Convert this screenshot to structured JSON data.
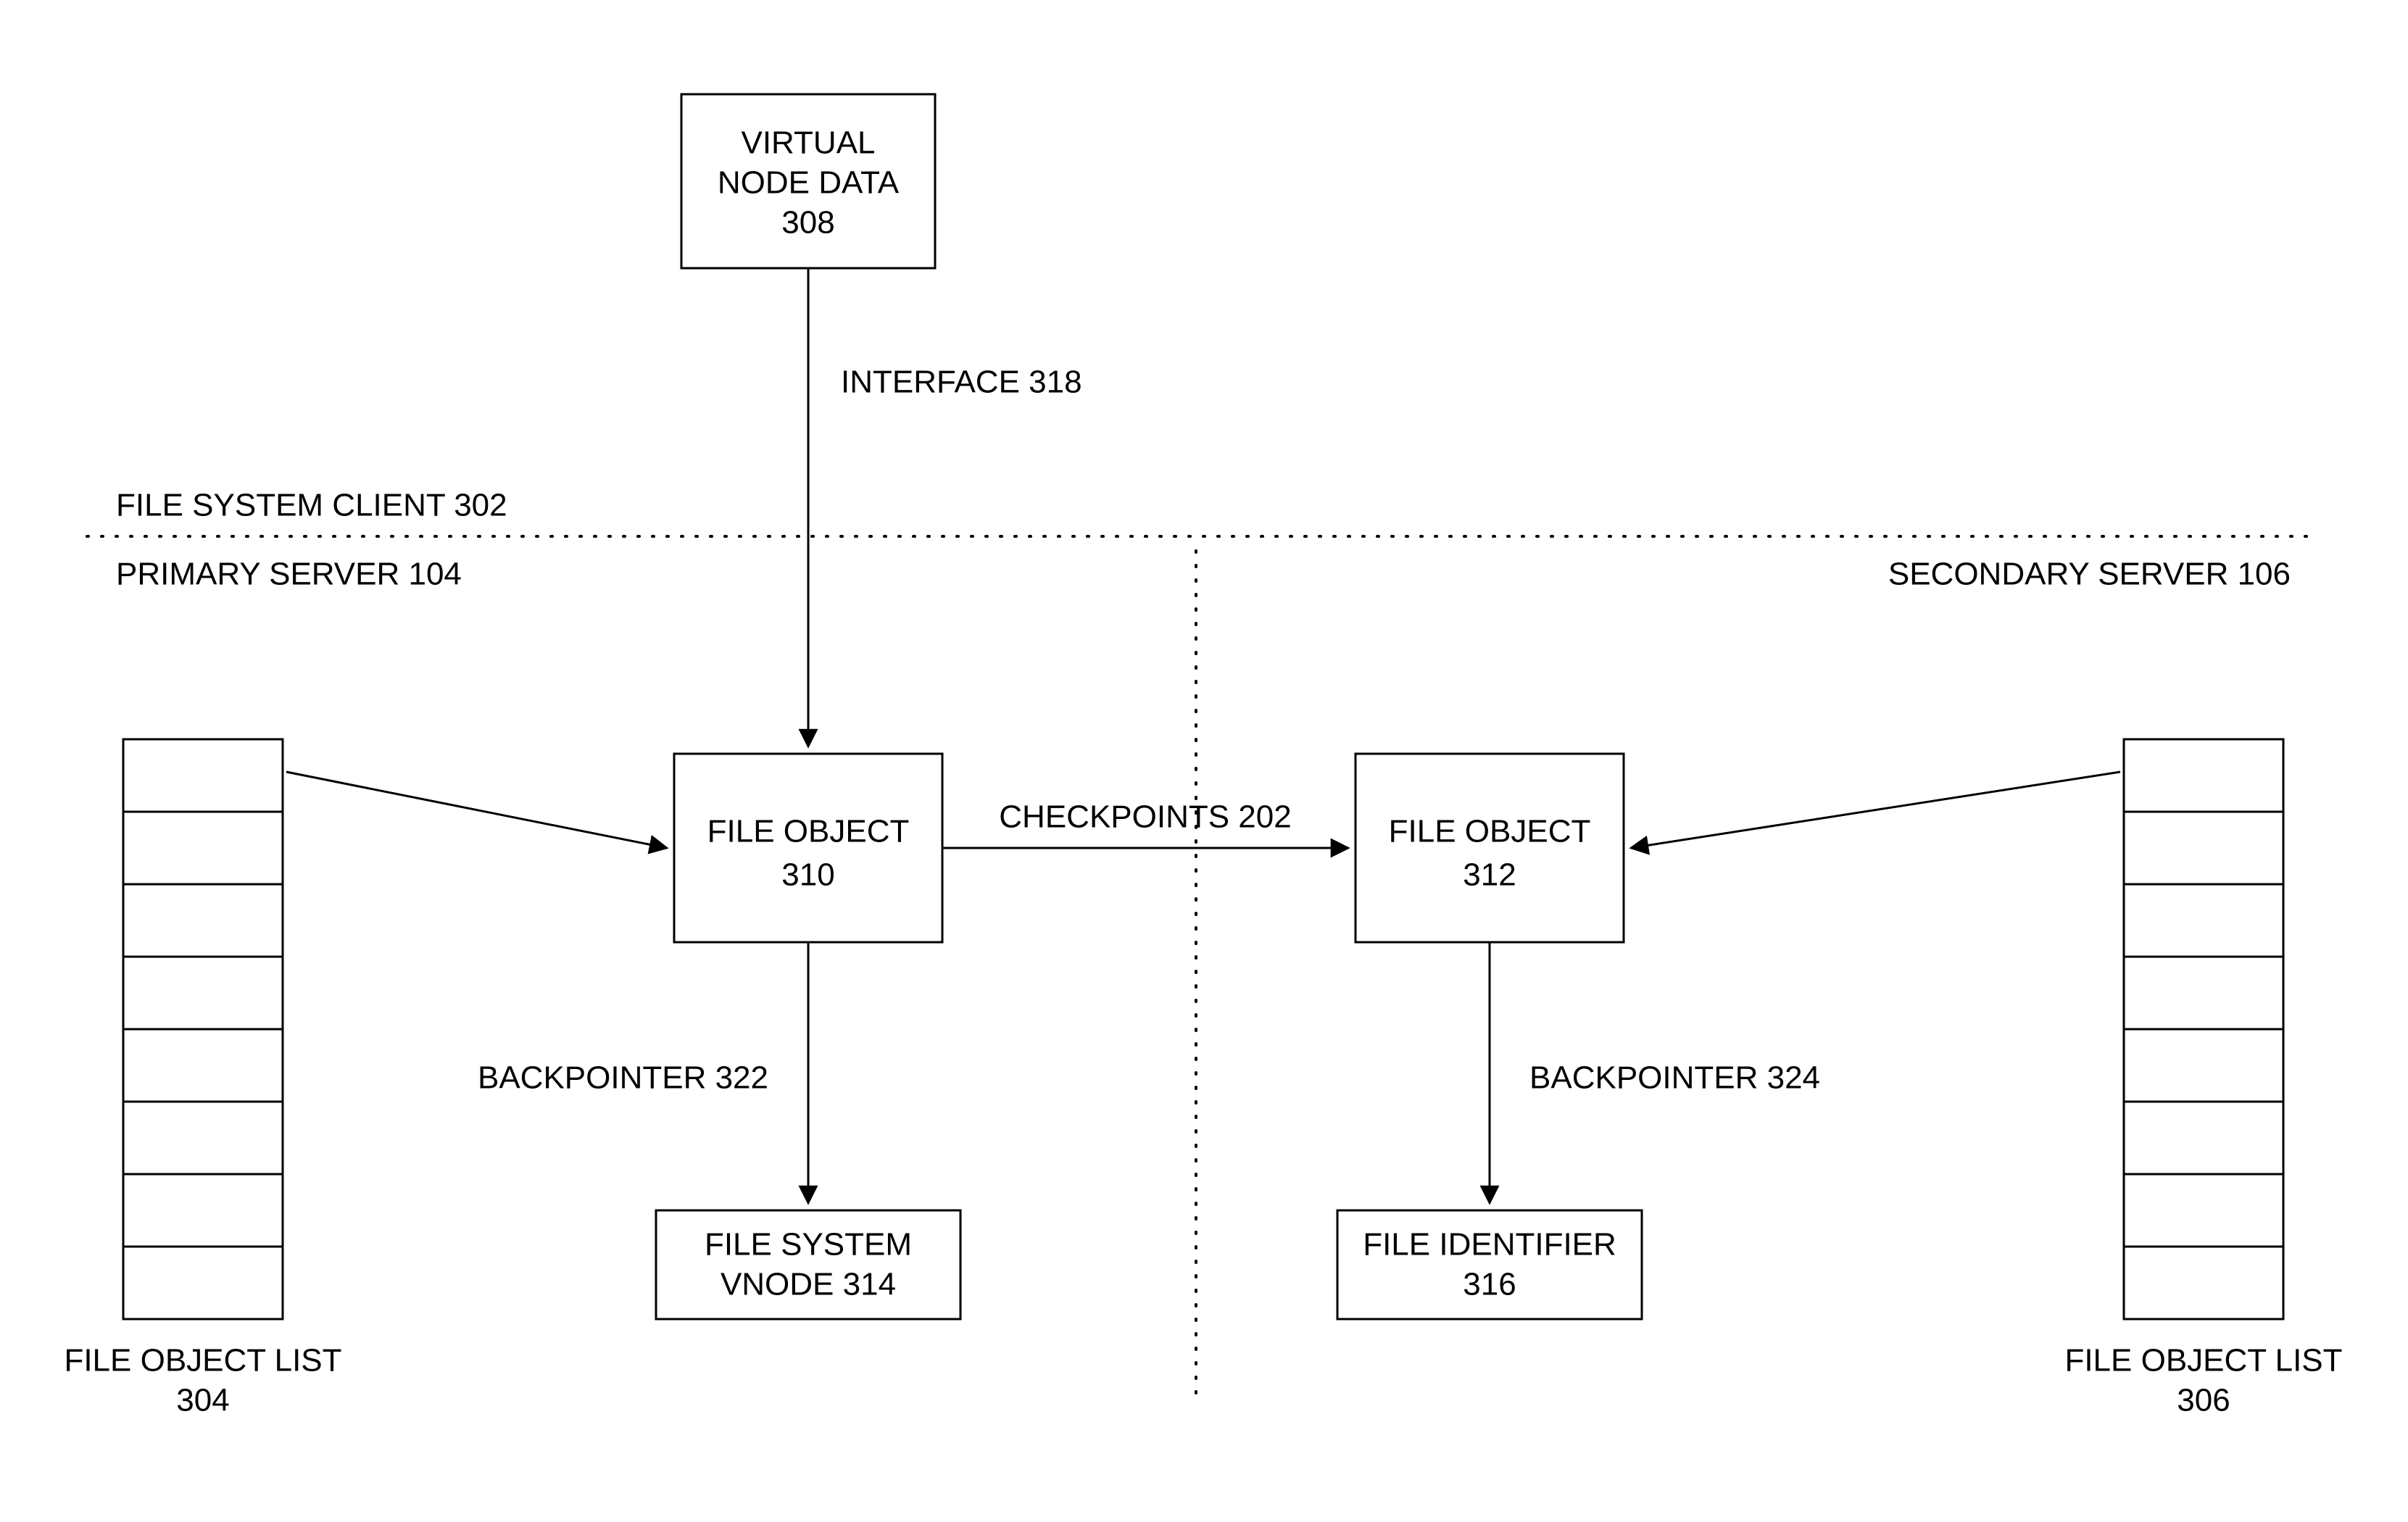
{
  "regions": {
    "client": "FILE SYSTEM CLIENT 302",
    "primary": "PRIMARY SERVER 104",
    "secondary": "SECONDARY SERVER 106"
  },
  "nodes": {
    "virtual_node_data": {
      "line1": "VIRTUAL",
      "line2": "NODE DATA",
      "ref": "308"
    },
    "file_object_primary": {
      "label": "FILE OBJECT",
      "ref": "310"
    },
    "file_object_secondary": {
      "label": "FILE OBJECT",
      "ref": "312"
    },
    "fs_vnode": {
      "line1": "FILE SYSTEM",
      "line2": "VNODE 314"
    },
    "file_identifier": {
      "line1": "FILE IDENTIFIER",
      "line2": "316"
    },
    "file_object_list_left": {
      "line1": "FILE OBJECT LIST",
      "ref": "304"
    },
    "file_object_list_right": {
      "line1": "FILE OBJECT LIST",
      "ref": "306"
    }
  },
  "edges": {
    "interface": "INTERFACE 318",
    "checkpoints": "CHECKPOINTS 202",
    "backpointer_left": "BACKPOINTER 322",
    "backpointer_right": "BACKPOINTER 324"
  }
}
